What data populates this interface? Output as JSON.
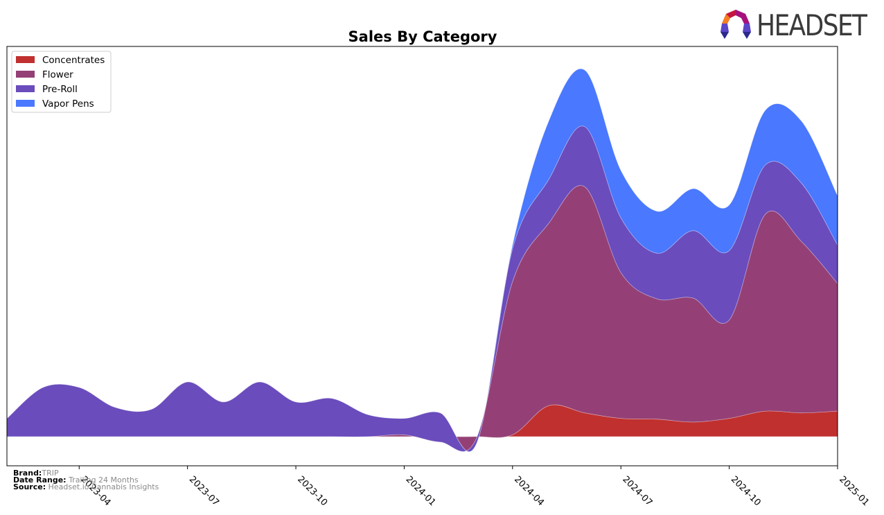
{
  "logo": {
    "text": "HEADSET"
  },
  "footer": {
    "brand_label": "Brand:",
    "brand_value": "TRIP",
    "date_range_label": "Date Range:",
    "date_range_value": "Trailing 24 Months",
    "source_label": "Source:",
    "source_value": "Headset.io Cannabis Insights"
  },
  "chart_data": {
    "type": "area",
    "stacked": true,
    "smooth": true,
    "title": "Sales By Category",
    "xlabel": "",
    "ylabel": "",
    "y_axis_visible": false,
    "grid": false,
    "legend_position": "top-left",
    "x": [
      "2023-02",
      "2023-03",
      "2023-04",
      "2023-05",
      "2023-06",
      "2023-07",
      "2023-08",
      "2023-09",
      "2023-10",
      "2023-11",
      "2023-12",
      "2024-01",
      "2024-02",
      "2024-03",
      "2024-04",
      "2024-05",
      "2024-06",
      "2024-07",
      "2024-08",
      "2024-09",
      "2024-10",
      "2024-11",
      "2024-12",
      "2025-01"
    ],
    "x_ticks": [
      "2023-04",
      "2023-07",
      "2023-10",
      "2024-01",
      "2024-04",
      "2024-07",
      "2024-10",
      "2025-01"
    ],
    "ylim": [
      -8,
      107
    ],
    "series": [
      {
        "name": "Concentrates",
        "color": "#c0302f",
        "values": [
          0,
          0,
          0,
          0,
          0,
          0,
          0,
          0,
          0,
          0,
          0,
          0,
          0,
          0,
          0.5,
          8.5,
          6.5,
          5,
          4.8,
          4,
          5,
          7,
          6.5,
          7
        ]
      },
      {
        "name": "Flower",
        "color": "#944076",
        "values": [
          0,
          0,
          0,
          0,
          0,
          0,
          0,
          0,
          0,
          0,
          0,
          0.5,
          -1.5,
          -0.5,
          42,
          50,
          62,
          40,
          33,
          34,
          27,
          54,
          47,
          35
        ]
      },
      {
        "name": "Pre-Roll",
        "color": "#6a4cbc",
        "values": [
          5,
          13.5,
          13.5,
          8,
          7.5,
          15,
          9.5,
          15,
          9.5,
          10.5,
          6,
          4.5,
          8,
          -1.5,
          9,
          12,
          16.5,
          15,
          12.5,
          18.5,
          19,
          13.5,
          16,
          10.5
        ]
      },
      {
        "name": "Vapor Pens",
        "color": "#4a78fe",
        "values": [
          0,
          0,
          0,
          0,
          0,
          0,
          0,
          0,
          0,
          0,
          0,
          0,
          0,
          0,
          1,
          16,
          15.5,
          13,
          11.5,
          11.5,
          12.5,
          15,
          17,
          13.5
        ]
      }
    ]
  }
}
